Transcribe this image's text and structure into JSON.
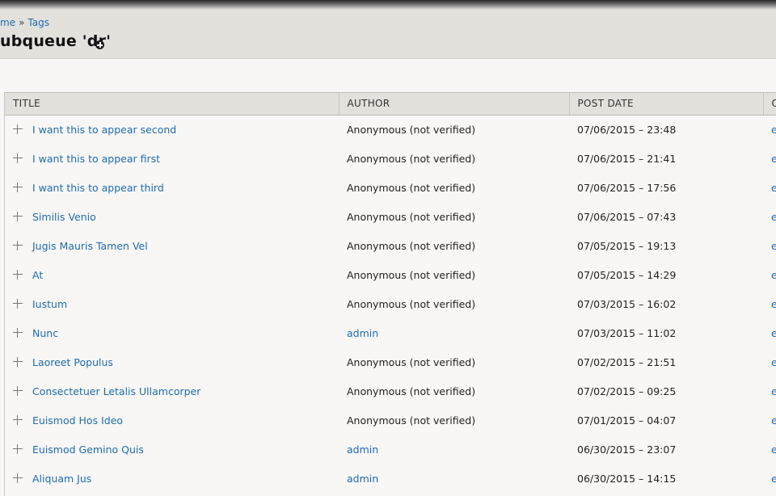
{
  "breadcrumb": {
    "home": "me",
    "separator": "»",
    "tags": "Tags"
  },
  "page": {
    "title": "ubqueue 'dr'"
  },
  "table": {
    "headers": [
      "TITLE",
      "AUTHOR",
      "POST DATE",
      "O"
    ],
    "rows": [
      {
        "title": "I want this to appear second",
        "author": "Anonymous (not verified)",
        "author_link": false,
        "date": "07/06/2015 – 23:48",
        "op": "e"
      },
      {
        "title": "I want this to appear first",
        "author": "Anonymous (not verified)",
        "author_link": false,
        "date": "07/06/2015 – 21:41",
        "op": "e"
      },
      {
        "title": "I want this to appear third",
        "author": "Anonymous (not verified)",
        "author_link": false,
        "date": "07/06/2015 – 17:56",
        "op": "e"
      },
      {
        "title": "Similis Venio",
        "author": "Anonymous (not verified)",
        "author_link": false,
        "date": "07/06/2015 – 07:43",
        "op": "e"
      },
      {
        "title": "Jugis Mauris Tamen Vel",
        "author": "Anonymous (not verified)",
        "author_link": false,
        "date": "07/05/2015 – 19:13",
        "op": "e"
      },
      {
        "title": "At",
        "author": "Anonymous (not verified)",
        "author_link": false,
        "date": "07/05/2015 – 14:29",
        "op": "e"
      },
      {
        "title": "Iustum",
        "author": "Anonymous (not verified)",
        "author_link": false,
        "date": "07/03/2015 – 16:02",
        "op": "e"
      },
      {
        "title": "Nunc",
        "author": "admin",
        "author_link": true,
        "date": "07/03/2015 – 11:02",
        "op": "e"
      },
      {
        "title": "Laoreet Populus",
        "author": "Anonymous (not verified)",
        "author_link": false,
        "date": "07/02/2015 – 21:51",
        "op": "e"
      },
      {
        "title": "Consectetuer Letalis Ullamcorper",
        "author": "Anonymous (not verified)",
        "author_link": false,
        "date": "07/02/2015 – 09:25",
        "op": "e"
      },
      {
        "title": "Euismod Hos Ideo",
        "author": "Anonymous (not verified)",
        "author_link": false,
        "date": "07/01/2015 – 04:07",
        "op": "e"
      },
      {
        "title": "Euismod Gemino Quis",
        "author": "admin",
        "author_link": true,
        "date": "06/30/2015 – 23:07",
        "op": "e"
      },
      {
        "title": "Aliquam Jus",
        "author": "admin",
        "author_link": true,
        "date": "06/30/2015 – 14:15",
        "op": "e"
      }
    ]
  },
  "icons": {
    "drag": "move-cross-icon",
    "shortcut": "add-shortcut-icon",
    "cursor": "mouse-pointer-icon"
  },
  "colors": {
    "link": "#1e6bb0",
    "header_bg": "#e2e1dc",
    "page_bg": "#f8f7f5"
  }
}
